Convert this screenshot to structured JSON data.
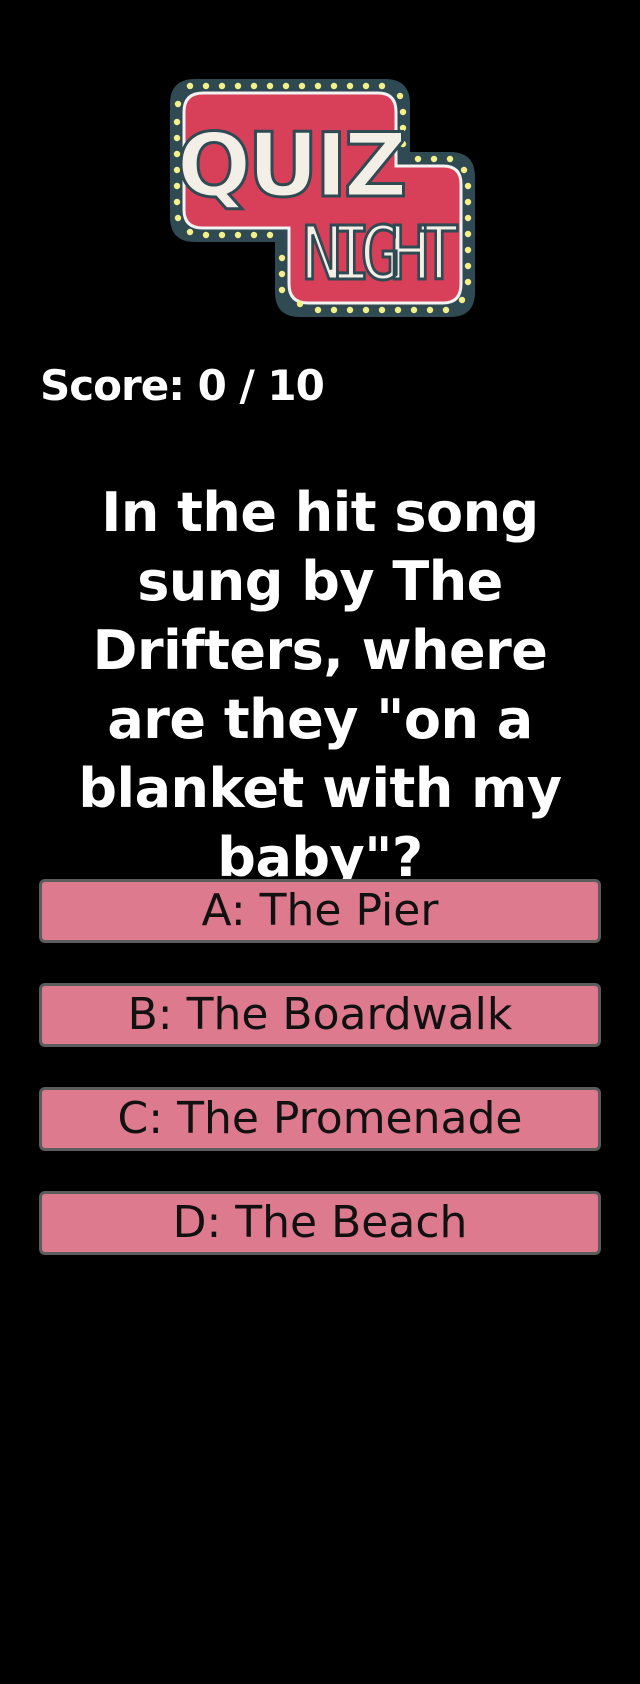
{
  "logo": {
    "line1": "QUIZ",
    "line2": "NIGHT"
  },
  "score": {
    "text": "Score: 0 / 10"
  },
  "question": {
    "text": "In the hit song sung by The Drifters, where are they \"on a blanket with my baby\"?"
  },
  "answers": [
    {
      "label": "A: The Pier"
    },
    {
      "label": "B: The Boardwalk"
    },
    {
      "label": "C: The Promenade"
    },
    {
      "label": "D: The Beach"
    }
  ],
  "colors": {
    "background": "#000000",
    "answer_fill": "#de7a8d",
    "answer_border": "#5c5c5c",
    "logo_red": "#d8405a",
    "logo_dark": "#2f4a52",
    "logo_bulb": "#f4f08a"
  }
}
